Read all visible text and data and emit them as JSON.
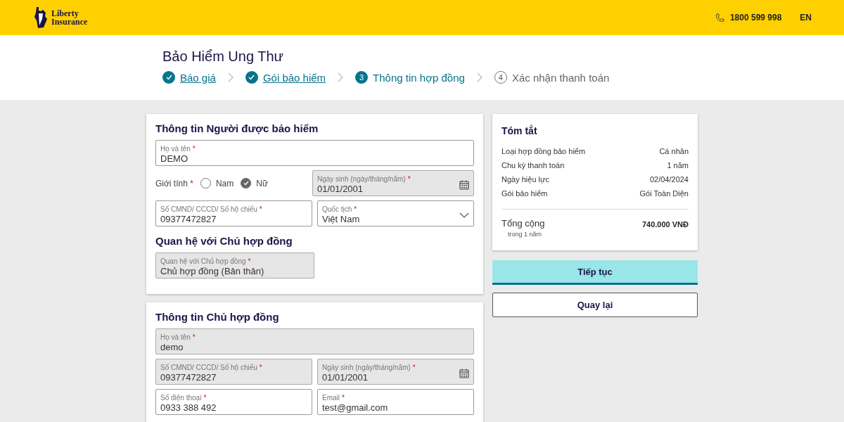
{
  "header": {
    "logo_line_1": "Liberty",
    "logo_line_2": "Insurance",
    "phone": "1800 599 998",
    "language": "EN"
  },
  "page_title": "Bảo Hiểm Ung Thư",
  "steps": [
    {
      "label": "Báo giá",
      "done": true,
      "selected": false
    },
    {
      "label": "Gói bảo hiểm",
      "done": true,
      "selected": false
    },
    {
      "marker": "3",
      "label": "Thông tin hợp đồng",
      "done": false,
      "selected": true
    },
    {
      "marker": "4",
      "label": "Xác nhận thanh toán",
      "done": false,
      "selected": false
    }
  ],
  "insured": {
    "title": "Thông tin Người được bảo hiểm",
    "full_name": {
      "label": "Họ và tên",
      "required_mark": "*",
      "value": "DEMO",
      "disabled": false
    },
    "gender": {
      "label": "Giới tính",
      "required_mark": "*",
      "options": [
        {
          "label": "Nam",
          "selected": false
        },
        {
          "label": "Nữ",
          "selected": true
        }
      ]
    },
    "birth_date": {
      "label": "Ngày sinh (ngày/tháng/năm)",
      "required_mark": "*",
      "value": "01/01/2001",
      "kind": "date",
      "disabled": true
    },
    "id_number": {
      "label": "Số CMND/ CCCD/ Số hộ chiếu",
      "required_mark": "*",
      "value": "09377472827",
      "disabled": false
    },
    "nationality": {
      "label": "Quốc tịch",
      "required_mark": "*",
      "value": "Việt Nam",
      "kind": "select",
      "disabled": false
    },
    "relation_title": "Quan hệ với Chủ hợp đồng",
    "relation": {
      "label": "Quan hệ với Chủ hợp đồng",
      "required_mark": "*",
      "value": "Chủ hợp đồng (Bản thân)",
      "disabled": true
    }
  },
  "holder": {
    "title": "Thông tin Chủ hợp đồng",
    "full_name": {
      "label": "Họ và tên",
      "required_mark": "*",
      "value": "demo",
      "disabled": true
    },
    "id_number": {
      "label": "Số CMND/ CCCD/ Số hộ chiếu",
      "required_mark": "*",
      "value": "09377472827",
      "disabled": true
    },
    "birth_date": {
      "label": "Ngày sinh (ngày/tháng/năm)",
      "required_mark": "*",
      "value": "01/01/2001",
      "kind": "date",
      "disabled": true
    },
    "phone": {
      "label": "Số điện thoại",
      "required_mark": "*",
      "value": "0933 388 492",
      "disabled": false
    },
    "email": {
      "label": "Email",
      "required_mark": "*",
      "value": "test@gmail.com",
      "disabled": false
    }
  },
  "summary": {
    "title": "Tóm tắt",
    "rows": [
      {
        "label": "Loại hợp đồng bảo hiểm",
        "value": "Cá nhân"
      },
      {
        "label": "Chu kỳ thanh toán",
        "value": "1 năm"
      },
      {
        "label": "Ngày hiệu lực",
        "value": "02/04/2024"
      },
      {
        "label": "Gói bảo hiểm",
        "value": "Gói Toàn Diện"
      }
    ],
    "total_label": "Tổng cộng",
    "total_note": "trong 1 năm",
    "total_value": "740.000 VNĐ"
  },
  "buttons": {
    "continue": "Tiếp tục",
    "back": "Quay lại"
  }
}
